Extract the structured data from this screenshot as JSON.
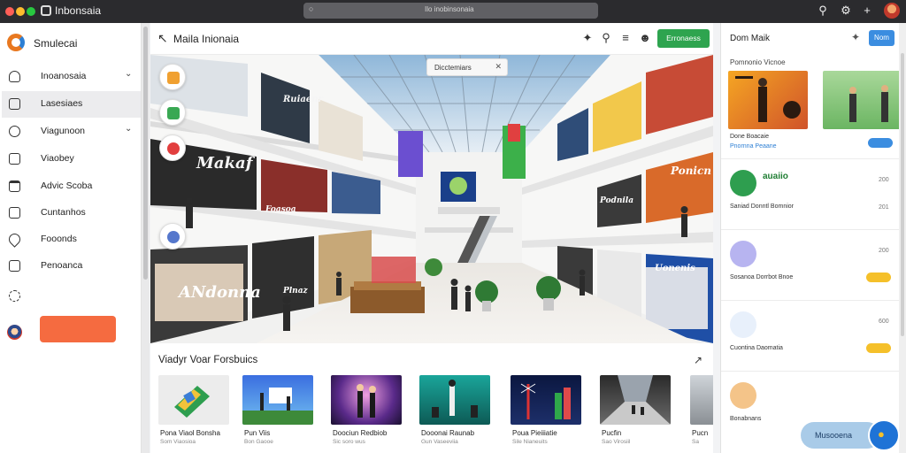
{
  "window": {
    "title": "Inbonsaia",
    "address": "Ilo inobinsonaia",
    "icons": [
      "search-icon",
      "settings-icon",
      "add-icon",
      "profile-avatar"
    ]
  },
  "sidebar": {
    "brand": "Smulecai",
    "items": [
      {
        "label": "Inoanosaia",
        "icon": "plant-icon",
        "chevron": true
      },
      {
        "label": "Lasesiaes",
        "icon": "box-icon",
        "chevron": false,
        "active": true
      },
      {
        "label": "Viagunoon",
        "icon": "compass-icon",
        "chevron": true
      },
      {
        "label": "Viaobey",
        "icon": "page-icon",
        "chevron": false
      },
      {
        "label": "Advic Scoba",
        "icon": "bag-icon",
        "chevron": false
      },
      {
        "label": "Cuntanhos",
        "icon": "square-icon",
        "chevron": false
      },
      {
        "label": "Fooonds",
        "icon": "pin-icon",
        "chevron": false
      },
      {
        "label": "Penoanca",
        "icon": "panel-icon",
        "chevron": false
      }
    ]
  },
  "main": {
    "title": "Maila Inionaia",
    "cta_label": "Erronaess",
    "header_icons": [
      "brush-icon",
      "search-icon",
      "menu-icon",
      "user-icon"
    ],
    "hero": {
      "chip_label": "Dicctemiars",
      "store_signs": [
        "Makaf",
        "Ruiaenr",
        "Ponicn",
        "ANdonna",
        "Uonenis",
        "Foasoa",
        "Plnaz",
        "Podnila"
      ]
    },
    "section": {
      "title": "Viadyr Voar Forsbuics",
      "cards": [
        {
          "title": "Pona Viaol Bonsha",
          "sub": "Som Viaosioa"
        },
        {
          "title": "Pun Viis",
          "sub": "Bon Gaooe"
        },
        {
          "title": "Doociun Redbiob",
          "sub": "Sic soro wus"
        },
        {
          "title": "Dooonai Raunab",
          "sub": "Gun Vaseeviia"
        },
        {
          "title": "Poua Pieiiiatie",
          "sub": "Sile Nianeuits"
        },
        {
          "title": "Pucfin",
          "sub": "Sao Virosiil"
        },
        {
          "title": "Pucn",
          "sub": "Sa"
        }
      ]
    }
  },
  "right_panel": {
    "title": "Dom Maik",
    "button_label": "Nom",
    "subheading": "Pomnonio Vicnoe",
    "caption": "Done Boacaie",
    "caption2": "Pnornna Peaane",
    "rows": [
      {
        "name": "auaiio",
        "meta": "Saniad  Donntl Bomnior",
        "num": "200",
        "sub": "201"
      },
      {
        "name": "",
        "meta": "Sosanoa  Dorrbot Bnoe",
        "num": "200",
        "sub": ""
      },
      {
        "name": "",
        "meta": "Cuontina  Daomatia",
        "num": "600",
        "sub": ""
      },
      {
        "name": "",
        "meta": "Bonabnans",
        "num": "",
        "sub": ""
      }
    ],
    "chat_label": "Musooena"
  },
  "colors": {
    "accent_green": "#2ea44f",
    "accent_blue": "#3b8de0",
    "accent_orange": "#f56b40",
    "badge_yellow": "#f5c02a"
  }
}
